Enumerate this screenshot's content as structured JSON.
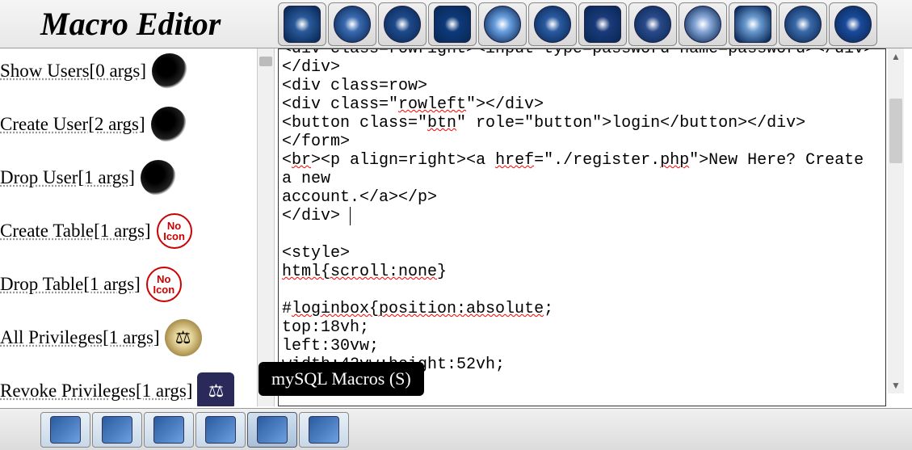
{
  "title": "Macro Editor",
  "sidebar": {
    "items": [
      {
        "label": "Show Users[0 args]",
        "icon": "head"
      },
      {
        "label": "Create User[2 args]",
        "icon": "head"
      },
      {
        "label": "Drop User[1 args]",
        "icon": "head"
      },
      {
        "label": "Create Table[1 args]",
        "icon": "noicon"
      },
      {
        "label": "Drop Table[1 args]",
        "icon": "noicon"
      },
      {
        "label": "All Privileges[1 args]",
        "icon": "scales"
      },
      {
        "label": "Revoke Privileges[1 args]",
        "icon": "scales-dark"
      }
    ]
  },
  "tooltip": "mySQL Macros (S)",
  "editor": {
    "lines": [
      {
        "t": "<div class=rowright><input type=password name=password></div>",
        "cut": true
      },
      {
        "t": "</div>"
      },
      {
        "t": "<div class=row>"
      },
      {
        "t": "<div class=\"rowleft\"></div>",
        "wavy": [
          "rowleft"
        ]
      },
      {
        "t": "<button class=\"btn\" role=\"button\">login</button></div>",
        "wavy": [
          "btn"
        ]
      },
      {
        "t": "</form>"
      },
      {
        "t": "<br><p align=right><a href=\"./register.php\">New Here? Create a new",
        "wavy": [
          "br",
          "href",
          "php"
        ]
      },
      {
        "t": "account.</a></p>"
      },
      {
        "t": "</div>",
        "caret": true
      },
      {
        "t": ""
      },
      {
        "t": "<style>"
      },
      {
        "t": "html{scroll:none}",
        "wavy": [
          "html{scroll:none"
        ]
      },
      {
        "t": ""
      },
      {
        "t": "#loginbox{position:absolute;",
        "wavy": [
          "loginbox{position:absolute"
        ]
      },
      {
        "t": "top:18vh;"
      },
      {
        "t": "left:30vw;"
      },
      {
        "t": "width:42vw;height:52vh;"
      },
      {
        "t": ""
      }
    ]
  },
  "top_toolbar": {
    "count": 12
  },
  "bottom_tabs": {
    "count": 6,
    "active_index": 4
  }
}
